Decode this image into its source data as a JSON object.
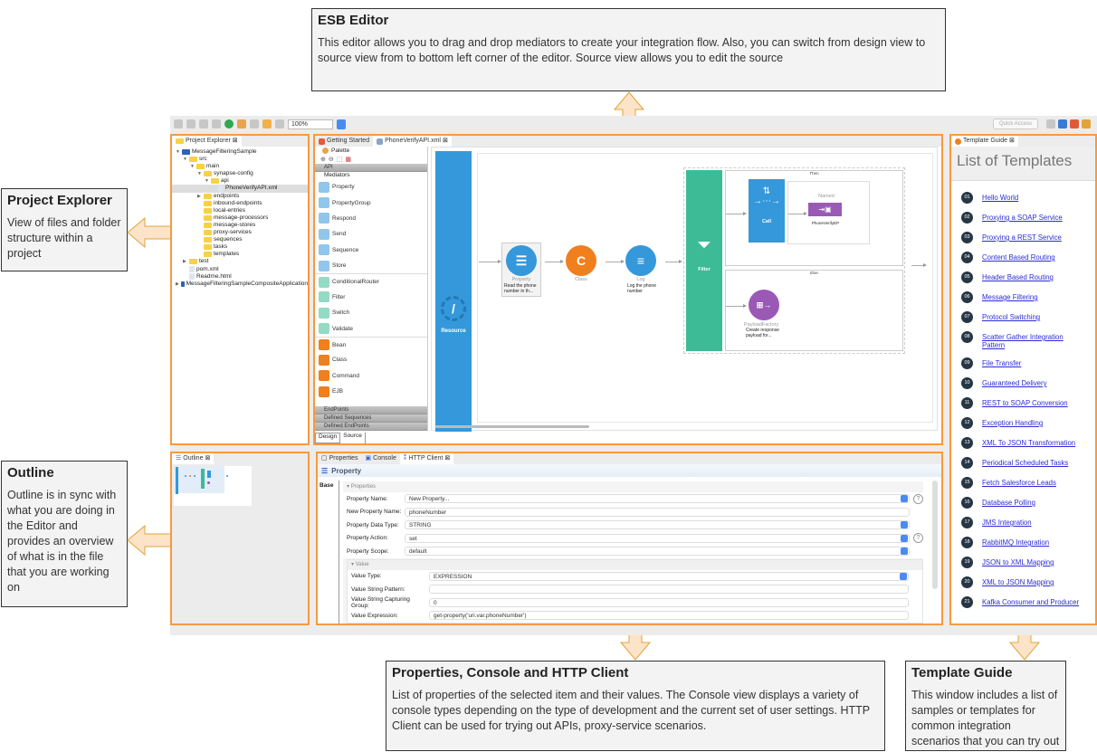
{
  "callouts": {
    "esb_editor": {
      "title": "ESB Editor",
      "body": "This editor allows you to drag and drop mediators to create your integration flow. Also, you can switch from design view to source view from to bottom left corner of the editor. Source view allows you to edit the source"
    },
    "project_explorer": {
      "title": "Project Explorer",
      "body": "View of files and folder structure within a project"
    },
    "outline": {
      "title": "Outline",
      "body": "Outline is in sync with what you are doing in the Editor and provides an overview of what is in the file that you are working on"
    },
    "properties": {
      "title": "Properties, Console and HTTP Client",
      "body": "List of properties of the selected item and their values. The Console view displays a variety of console types depending on the type of development and the current set of user settings. HTTP Client can be used for trying out APIs, proxy-service scenarios."
    },
    "template_guide": {
      "title": "Template Guide",
      "body": "This window includes a list of samples or templates for common integration scenarios that you can try out"
    }
  },
  "toolbar": {
    "zoom_value": "100%",
    "quick_access_placeholder": "Quick Access"
  },
  "project_explorer": {
    "tab_label": "Project Explorer",
    "tree": [
      {
        "label": "MessageFilteringSample",
        "type": "project",
        "expanded": true
      },
      {
        "label": "src",
        "type": "folder",
        "expanded": true
      },
      {
        "label": "main",
        "type": "folder",
        "expanded": true
      },
      {
        "label": "synapse-config",
        "type": "folder",
        "expanded": true
      },
      {
        "label": "api",
        "type": "folder",
        "expanded": true
      },
      {
        "label": "PhoneVerifyAPI.xml",
        "type": "file",
        "selected": true
      },
      {
        "label": "endpoints",
        "type": "folder",
        "expanded": false
      },
      {
        "label": "inbound-endpoints",
        "type": "folder"
      },
      {
        "label": "local-entries",
        "type": "folder"
      },
      {
        "label": "message-processors",
        "type": "folder"
      },
      {
        "label": "message-stores",
        "type": "folder"
      },
      {
        "label": "proxy-services",
        "type": "folder"
      },
      {
        "label": "sequences",
        "type": "folder"
      },
      {
        "label": "tasks",
        "type": "folder"
      },
      {
        "label": "templates",
        "type": "folder"
      },
      {
        "label": "test",
        "type": "folder",
        "expanded": false
      },
      {
        "label": "pom.xml",
        "type": "file"
      },
      {
        "label": "Readme.html",
        "type": "file"
      },
      {
        "label": "MessageFilteringSampleCompositeApplication",
        "type": "project",
        "expanded": false
      }
    ]
  },
  "editor": {
    "tabs": [
      {
        "label": "Getting Started",
        "active": false
      },
      {
        "label": "PhoneVerifyAPI.xml",
        "active": true
      }
    ],
    "palette": {
      "title": "Palette",
      "drawers": {
        "api": "API",
        "mediators": "Mediators",
        "endpoints": "EndPoints",
        "defined_sequences": "Defined Sequences",
        "defined_endpoints": "Defined EndPoints"
      },
      "items": [
        "Property",
        "PropertyGroup",
        "Respond",
        "Send",
        "Sequence",
        "Store",
        "ConditionalRouter",
        "Filter",
        "Switch",
        "Validate",
        "Bean",
        "Class",
        "Command",
        "EJB"
      ]
    },
    "bottom_tabs": [
      "Design",
      "Source"
    ],
    "flow": {
      "resource_label": "Resource",
      "property": {
        "label": "Property",
        "desc": "Read the phone number in th..."
      },
      "class": {
        "label": "Class"
      },
      "log": {
        "label": "Log",
        "desc": "Log the phone number"
      },
      "filter": {
        "label": "Filter",
        "then_label": "Then",
        "else_label": "Else"
      },
      "call": {
        "label": "Call"
      },
      "endpoint": {
        "type": "Named",
        "name": "PhoneVerifyEP"
      },
      "payload": {
        "label": "PayloadFactory",
        "desc": "Create response payload for..."
      }
    },
    "colors": {
      "resource": "#3498db",
      "filter": "#3dbb96",
      "class": "#f07f1e",
      "payload": "#9b59b6",
      "highlight": "#f79a3e"
    }
  },
  "outline": {
    "tab_label": "Outline"
  },
  "properties_panel": {
    "tabs": [
      {
        "label": "Properties"
      },
      {
        "label": "Console"
      },
      {
        "label": "HTTP Client",
        "active": true
      }
    ],
    "header": "Property",
    "side_tab": "Base",
    "section": "Properties",
    "fields": [
      {
        "label": "Property Name:",
        "value": "New Property...",
        "dropdown": true,
        "help": true
      },
      {
        "label": "New Property Name:",
        "value": "phoneNumber"
      },
      {
        "label": "Property Data Type:",
        "value": "STRING",
        "dropdown": true
      },
      {
        "label": "Property Action:",
        "value": "set",
        "dropdown": true,
        "help": true
      },
      {
        "label": "Property Scope:",
        "value": "default",
        "dropdown": true
      }
    ],
    "value_section": "Value",
    "value_fields": [
      {
        "label": "Value Type:",
        "value": "EXPRESSION",
        "dropdown": true
      },
      {
        "label": "Value String Pattern:",
        "value": ""
      },
      {
        "label": "Value String Capturing Group:",
        "value": "0"
      },
      {
        "label": "Value Expression:",
        "value": "get-property('uri.var.phoneNumber')"
      }
    ]
  },
  "template_guide": {
    "tab_label": "Template Guide",
    "heading": "List of Templates",
    "items": [
      {
        "num": "01",
        "label": "Hello World"
      },
      {
        "num": "02",
        "label": "Proxying a SOAP Service"
      },
      {
        "num": "03",
        "label": "Proxying a REST Service"
      },
      {
        "num": "04",
        "label": "Content Based Routing"
      },
      {
        "num": "05",
        "label": "Header Based Routing"
      },
      {
        "num": "06",
        "label": "Message Filtering"
      },
      {
        "num": "07",
        "label": "Protocol Switching"
      },
      {
        "num": "08",
        "label": "Scatter Gather Integration Pattern"
      },
      {
        "num": "09",
        "label": "File Transfer"
      },
      {
        "num": "10",
        "label": "Guaranteed Delivery"
      },
      {
        "num": "11",
        "label": "REST to SOAP Conversion"
      },
      {
        "num": "12",
        "label": "Exception Handling"
      },
      {
        "num": "13",
        "label": "XML To JSON Transformation"
      },
      {
        "num": "14",
        "label": "Periodical Scheduled Tasks"
      },
      {
        "num": "15",
        "label": "Fetch Salesforce Leads"
      },
      {
        "num": "16",
        "label": "Database Polling"
      },
      {
        "num": "17",
        "label": "JMS Integration"
      },
      {
        "num": "18",
        "label": "RabbitMQ Integration"
      },
      {
        "num": "19",
        "label": "JSON to XML Mapping"
      },
      {
        "num": "20",
        "label": "XML to JSON Mapping"
      },
      {
        "num": "21",
        "label": "Kafka Consumer and Producer"
      }
    ]
  }
}
